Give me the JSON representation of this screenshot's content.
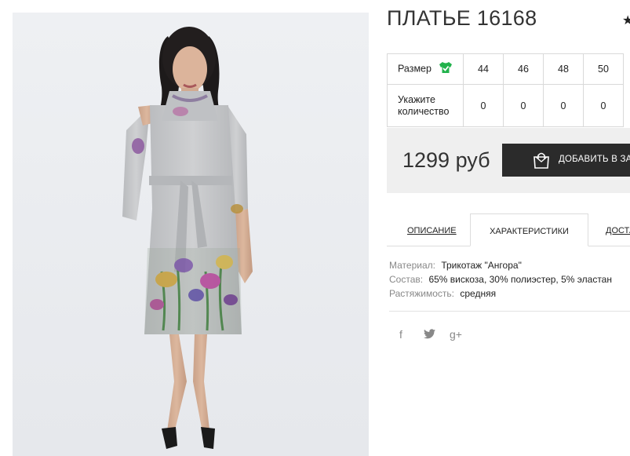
{
  "product": {
    "title": "ПЛАТЬЕ 16168",
    "price": "1299 руб",
    "add_to_cart_label": "ДОБАВИТЬ В ЗАКАЗ"
  },
  "size_table": {
    "size_label": "Размер",
    "qty_label_line1": "Укажите",
    "qty_label_line2": "количество",
    "sizes": [
      "44",
      "46",
      "48",
      "50"
    ],
    "quantities": [
      "0",
      "0",
      "0",
      "0"
    ]
  },
  "tabs": [
    {
      "label": "ОПИСАНИЕ",
      "active": false
    },
    {
      "label": "ХАРАКТЕРИСТИКИ",
      "active": true
    },
    {
      "label": "ДОСТАВКА",
      "active": false
    }
  ],
  "specs": [
    {
      "key": "Материал:",
      "value": "Трикотаж \"Ангора\""
    },
    {
      "key": "Состав:",
      "value": "65% вискоза, 30% полиэстер, 5% эластан"
    },
    {
      "key": "Растяжимость:",
      "value": "средняя"
    }
  ],
  "social": {
    "facebook": "f",
    "twitter": "twitter-icon",
    "gplus": "g+"
  },
  "colors": {
    "accent_green": "#22b24c",
    "button_dark": "#2b2b2b",
    "price_bg": "#efefef"
  }
}
